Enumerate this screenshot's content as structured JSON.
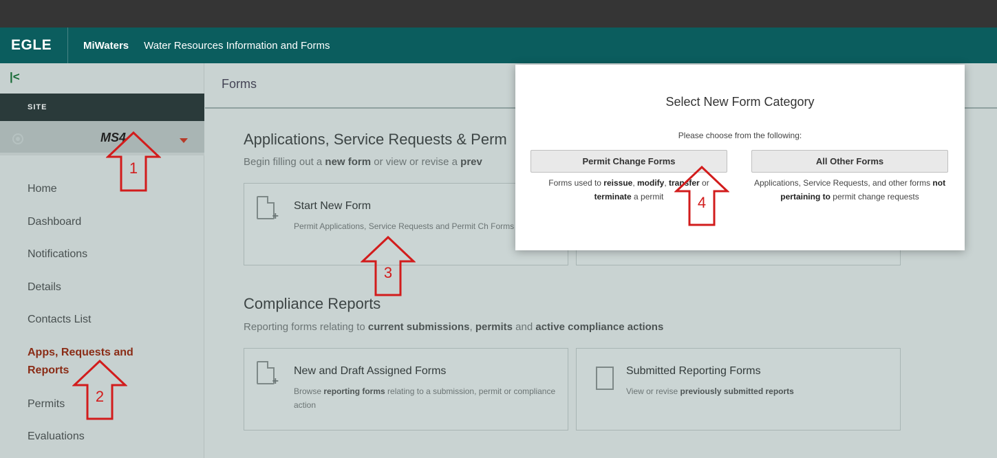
{
  "header": {
    "logo": "EGLE",
    "app_name": "MiWaters",
    "app_subtitle": "Water Resources Information and Forms"
  },
  "sidebar": {
    "collapse_icon": "collapse-left-icon",
    "site_header": "SITE",
    "site_name": "MS4",
    "items": [
      {
        "label": "Home"
      },
      {
        "label": "Dashboard"
      },
      {
        "label": "Notifications"
      },
      {
        "label": "Details"
      },
      {
        "label": "Contacts List"
      },
      {
        "label": "Apps, Requests and Reports",
        "active": true
      },
      {
        "label": "Permits"
      },
      {
        "label": "Evaluations"
      }
    ]
  },
  "main": {
    "title": "Forms",
    "applications": {
      "title": "Applications, Service Requests & Perm",
      "desc_parts": [
        "Begin filling out a ",
        "new form",
        " or view or revise a ",
        "prev"
      ],
      "card": {
        "title": "Start New Form",
        "desc": "Permit Applications, Service Requests and Permit Ch Forms"
      }
    },
    "compliance": {
      "title": "Compliance Reports",
      "desc_parts": [
        "Reporting forms relating to ",
        "current submissions",
        ", ",
        "permits",
        " and ",
        "active compliance actions"
      ],
      "cards": [
        {
          "title": "New and Draft Assigned Forms",
          "desc_parts": [
            "Browse ",
            "reporting forms",
            " relating to a submission, permit or compliance action"
          ]
        },
        {
          "title": "Submitted Reporting Forms",
          "desc_parts": [
            "View or revise ",
            "previously submitted reports"
          ]
        }
      ]
    }
  },
  "modal": {
    "title": "Select New Form Category",
    "subtitle": "Please choose from the following:",
    "permit_button": "Permit Change Forms",
    "permit_desc_parts": [
      "Forms used to ",
      "reissue",
      ", ",
      "modify",
      ", ",
      "transfer",
      " or ",
      "terminate",
      " a permit"
    ],
    "other_button": "All Other Forms",
    "other_desc_parts": [
      "Applications, Service Requests, and other forms ",
      "not pertaining to",
      " permit change requests"
    ]
  },
  "annotations": [
    {
      "number": "1"
    },
    {
      "number": "2"
    },
    {
      "number": "3"
    },
    {
      "number": "4"
    }
  ]
}
